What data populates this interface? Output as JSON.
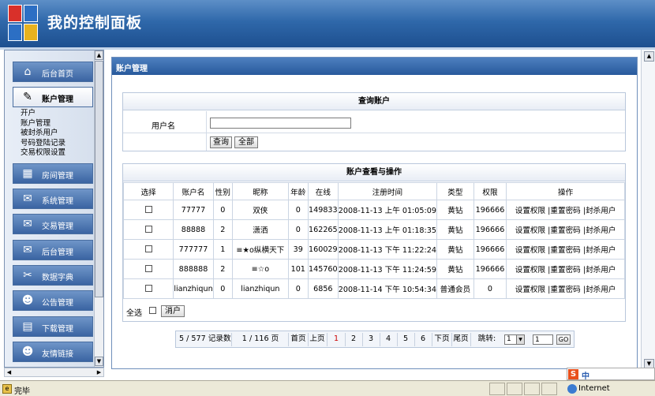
{
  "header": {
    "title": "我的控制面板"
  },
  "sidebar": {
    "items": [
      {
        "label": "后台首页",
        "icon": "home-icon",
        "glyph": "⌂"
      },
      {
        "label": "账户管理",
        "icon": "account-icon",
        "glyph": "✎",
        "active": true
      },
      {
        "label": "房间管理",
        "icon": "room-icon",
        "glyph": "▦"
      },
      {
        "label": "系统管理",
        "icon": "system-icon",
        "glyph": "✉"
      },
      {
        "label": "交易管理",
        "icon": "trade-icon",
        "glyph": "✉"
      },
      {
        "label": "后台管理",
        "icon": "admin-icon",
        "glyph": "✉"
      },
      {
        "label": "数据字典",
        "icon": "tools-icon",
        "glyph": "✂"
      },
      {
        "label": "公告管理",
        "icon": "user-icon",
        "glyph": "☻"
      },
      {
        "label": "下载管理",
        "icon": "download-icon",
        "glyph": "▤"
      },
      {
        "label": "友情链接",
        "icon": "link-user-icon",
        "glyph": "☻"
      }
    ],
    "submenu": [
      "开户",
      "账户管理",
      "被封杀用户",
      "号码登陆记录",
      "交易权限设置"
    ]
  },
  "main": {
    "title": "账户管理",
    "search": {
      "heading": "查询账户",
      "label": "用户名",
      "value": "",
      "query_button": "查询",
      "all_button": "全部"
    },
    "accounts": {
      "heading": "账户查看与操作",
      "columns": [
        "选择",
        "账户名",
        "性别",
        "昵称",
        "年龄",
        "在线",
        "注册时间",
        "类型",
        "权限",
        "操作"
      ],
      "rows": [
        {
          "name": "77777",
          "gender": "0",
          "nick": "双侠",
          "age": "0",
          "online": "149833",
          "time": "2008-11-13 上午 01:05:09",
          "type": "黄钻",
          "perm": "196666"
        },
        {
          "name": "88888",
          "gender": "2",
          "nick": "潇洒",
          "age": "0",
          "online": "162265",
          "time": "2008-11-13 上午 01:18:35",
          "type": "黄钻",
          "perm": "196666"
        },
        {
          "name": "777777",
          "gender": "1",
          "nick": "≡★o纵横天下",
          "age": "39",
          "online": "160029",
          "time": "2008-11-13 下午 11:22:24",
          "type": "黄钻",
          "perm": "196666"
        },
        {
          "name": "888888",
          "gender": "2",
          "nick": "≡☆o",
          "age": "101",
          "online": "145760",
          "time": "2008-11-13 下午 11:24:59",
          "type": "黄钻",
          "perm": "196666"
        },
        {
          "name": "lianzhiqun",
          "gender": "0",
          "nick": "lianzhiqun",
          "age": "0",
          "online": "6856",
          "time": "2008-11-14 下午 10:54:34",
          "type": "普通会员",
          "perm": "0"
        }
      ],
      "ops": {
        "set_perm": "设置权限",
        "sep": "|",
        "reset_pwd": "重置密码",
        "ban": "封杀用户"
      },
      "select_all": "全选",
      "open_button": "消户"
    },
    "pager": {
      "summary": "5 / 577 记录数",
      "pages_info": "1 / 116 页",
      "first": "首页",
      "prev": "上页",
      "pages": [
        "1",
        "2",
        "3",
        "4",
        "5",
        "6"
      ],
      "next": "下页",
      "last": "尾页",
      "jump_label": "跳转:",
      "jump_select": "1",
      "jump_input": "1",
      "go": "GO"
    }
  },
  "statusbar": {
    "text": "完毕",
    "zone": "Internet"
  },
  "ime": {
    "label": "中"
  },
  "colors": {
    "header": "#2f68aa",
    "page_current": "#cc0000"
  }
}
